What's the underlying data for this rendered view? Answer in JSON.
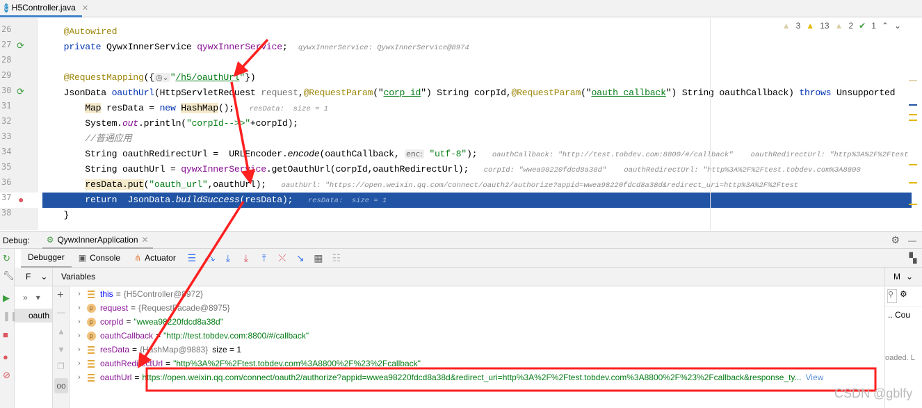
{
  "editor": {
    "tab_label": "H5Controller.java",
    "inspections": {
      "weak_warnings": "3",
      "warnings": "13",
      "typos": "2",
      "ok": "1"
    },
    "line_numbers": [
      "26",
      "27",
      "28",
      "29",
      "30",
      "31",
      "32",
      "33",
      "34",
      "35",
      "36",
      "37",
      "38"
    ],
    "lines": [
      [
        [
          "ann",
          "    @Autowired"
        ]
      ],
      [
        [
          "kw",
          "    private "
        ],
        [
          "",
          "QywxInnerService "
        ],
        [
          "fld",
          "qywxInnerService"
        ],
        [
          "",
          ";  "
        ],
        [
          "hint",
          "qywxInnerService: QywxInnerService@8974"
        ]
      ],
      [],
      [
        [
          "ann",
          "    @RequestMapping"
        ],
        [
          "",
          "({"
        ],
        [
          "ph",
          "◎⌄"
        ],
        [
          "str",
          "\""
        ],
        [
          "str und",
          "/h5/oauthUrl"
        ],
        [
          "str",
          "\""
        ],
        [
          "",
          "})"
        ]
      ],
      [
        [
          "",
          "    JsonData "
        ],
        [
          "kw",
          "oauthUrl"
        ],
        [
          "",
          "(HttpServletRequest "
        ],
        [
          "vv",
          "request"
        ],
        [
          "",
          ","
        ],
        [
          "ann",
          "@RequestParam"
        ],
        [
          "",
          "(\""
        ],
        [
          "str und",
          "corp_id"
        ],
        [
          "",
          "\") String corpId,"
        ],
        [
          "ann",
          "@RequestParam"
        ],
        [
          "",
          "(\""
        ],
        [
          "str und",
          "oauth_callback"
        ],
        [
          "",
          "\") String oauthCallback) "
        ],
        [
          "kw",
          "throws"
        ],
        [
          "",
          " Unsupported"
        ]
      ],
      [
        [
          "",
          "        "
        ],
        [
          "bgy",
          "Map"
        ],
        [
          "",
          " resData = "
        ],
        [
          "kw",
          "new "
        ],
        [
          "bgy",
          "HashMap"
        ],
        [
          "",
          "();  "
        ],
        [
          "hint",
          " resData:  size = 1"
        ]
      ],
      [
        [
          "",
          "        System."
        ],
        [
          "fld it",
          "out"
        ],
        [
          "",
          ".println("
        ],
        [
          "str",
          "\"corpId-->>\""
        ],
        [
          "",
          "+corpId);"
        ]
      ],
      [
        [
          "cm",
          "        //普通应用"
        ]
      ],
      [
        [
          "",
          "        String oauthRedirectUrl =  URLEncoder."
        ],
        [
          "it",
          "encode"
        ],
        [
          "",
          "(oauthCallback, "
        ],
        [
          "ph",
          "enc:"
        ],
        [
          "str",
          " \"utf-8\""
        ],
        [
          "",
          ");  "
        ],
        [
          "hint",
          " oauthCallback: \"http://test.tobdev.com:8800/#/callback\"    oauthRedirectUrl: \"http%3A%2F%2Ftest"
        ]
      ],
      [
        [
          "",
          "        String oauthUrl = "
        ],
        [
          "fld",
          "qywxInnerService"
        ],
        [
          "",
          ".getOauthUrl(corpId,oauthRedirectUrl);  "
        ],
        [
          "hint",
          " corpId: \"wwea98220fdcd8a38d\"    oauthRedirectUrl: \"http%3A%2F%2Ftest.tobdev.com%3A8800"
        ]
      ],
      [
        [
          "",
          "        "
        ],
        [
          "bgy",
          "resData.put"
        ],
        [
          "",
          "("
        ],
        [
          "str",
          "\"oauth_url\""
        ],
        [
          "",
          ",oauthUrl);  "
        ],
        [
          "hint",
          " oauthUrl: \"https://open.weixin.qq.com/connect/oauth2/authorize?appid=wwea98220fdcd8a38d&redirect_uri=http%3A%2F%2Ftest"
        ]
      ],
      [
        [
          "kw",
          "        return"
        ],
        [
          "",
          "  JsonData."
        ],
        [
          "it",
          "buildSuccess"
        ],
        [
          "",
          "(resData);  "
        ],
        [
          "hint",
          " resData:  size = 1"
        ]
      ],
      [
        [
          "",
          "    }"
        ]
      ]
    ]
  },
  "debug": {
    "label": "Debug:",
    "config_tab": "QywxInnerApplication",
    "tabs": [
      "Debugger",
      "Console",
      "Actuator"
    ],
    "frames_label": "F",
    "frame_item": "oauth",
    "variables_header": "Variables",
    "right_tab": "M",
    "right_col": "Cou",
    "right_status": "oaded. L",
    "variables": [
      {
        "icon": "field",
        "name": "this",
        "value": "{H5Controller@8972}",
        "type": "obj"
      },
      {
        "icon": "param",
        "name": "request",
        "value": "{RequestFacade@8975}",
        "type": "obj"
      },
      {
        "icon": "param",
        "name": "corpId",
        "value": "\"wwea98220fdcd8a38d\"",
        "type": "str"
      },
      {
        "icon": "param",
        "name": "oauthCallback",
        "value": "\"http://test.tobdev.com:8800/#/callback\"",
        "type": "str"
      },
      {
        "icon": "field",
        "name": "resData",
        "value": "{HashMap@9883}",
        "extra": "size = 1",
        "type": "obj"
      },
      {
        "icon": "field",
        "name": "oauthRedirectUrl",
        "value": "\"http%3A%2F%2Ftest.tobdev.com%3A8800%2F%23%2Fcallback\"",
        "type": "str"
      },
      {
        "icon": "field",
        "name": "oauthUrl",
        "value": "https://open.weixin.qq.com/connect/oauth2/authorize?appid=wwea98220fdcd8a38d&redirect_uri=http%3A%2F%2Ftest.tobdev.com%3A8800%2F%23%2Fcallback&response_ty...",
        "extra": "View",
        "type": "str"
      }
    ]
  },
  "watermark": "CSDN @gblfy",
  "colors": {
    "annotation_red": "#ff2020",
    "selection": "#2154a4"
  }
}
